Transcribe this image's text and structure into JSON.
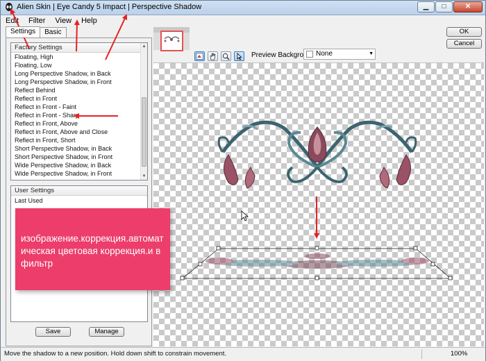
{
  "window": {
    "title": "Alien Skin | Eye Candy 5 Impact | Perspective Shadow",
    "minimize": "▁",
    "maximize": "□",
    "close": "✕"
  },
  "menu": [
    "Edit",
    "Filter",
    "View",
    "Help"
  ],
  "tabs": [
    "Settings",
    "Basic"
  ],
  "factory_settings": {
    "header": "Factory Settings",
    "items": [
      "Floating, High",
      "Floating, Low",
      "Long Perspective Shadow, in Back",
      "Long Perspective Shadow, in Front",
      "Reflect Behind",
      "Reflect in Front",
      "Reflect in Front - Faint",
      "Reflect in Front - Sharp",
      "Reflect in Front, Above",
      "Reflect in Front, Above and Close",
      "Reflect in Front, Short",
      "Short Perspective Shadow, in Back",
      "Short Perspective Shadow, in Front",
      "Wide Perspective Shadow, in Back",
      "Wide Perspective Shadow, in Front"
    ]
  },
  "user_settings": {
    "header": "User Settings",
    "items": [
      "Last Used"
    ]
  },
  "buttons": {
    "save": "Save",
    "manage": "Manage",
    "ok": "OK",
    "cancel": "Cancel"
  },
  "preview": {
    "label": "Preview Background:",
    "value": "None"
  },
  "tools": [
    "toggle-preview-icon",
    "hand-icon",
    "zoom-icon",
    "pointer-icon"
  ],
  "status": {
    "message": "Move the shadow to a new position. Hold down shift to constrain movement.",
    "zoom": "100%"
  },
  "overlay": {
    "text": "изображение.коррекция.автоматическая цветовая коррекция.и в фильтр",
    "color": "#ec3d6b"
  },
  "colors": {
    "annotation_arrow": "#e52222",
    "thumbnail_border": "#e85050"
  }
}
